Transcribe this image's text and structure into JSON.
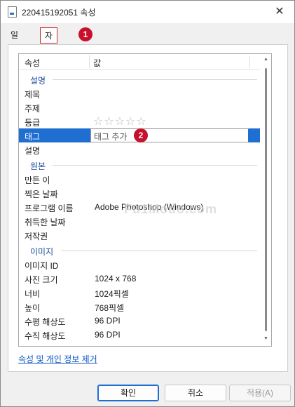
{
  "window": {
    "title": "220415192051 속성",
    "close_glyph": "✕"
  },
  "tabs": [
    {
      "label": "일반"
    },
    {
      "label": "자세히"
    }
  ],
  "markers": [
    "1",
    "2"
  ],
  "list": {
    "header": {
      "col1": "속성",
      "col2": "값"
    },
    "groups": {
      "description": "설명",
      "origin": "원본",
      "image": "이미지"
    },
    "rows": {
      "title": {
        "key": "제목",
        "value": ""
      },
      "subject": {
        "key": "주제",
        "value": ""
      },
      "rating": {
        "key": "등급",
        "value": "☆☆☆☆☆"
      },
      "tags": {
        "key": "태그",
        "value": "태그 추가"
      },
      "comments": {
        "key": "설명",
        "value": ""
      },
      "author": {
        "key": "만든 이",
        "value": ""
      },
      "date_taken": {
        "key": "찍은 날짜",
        "value": ""
      },
      "program": {
        "key": "프로그램 이름",
        "value": "Adobe Photoshop (Windows)"
      },
      "date_acquired": {
        "key": "취득한 날짜",
        "value": ""
      },
      "copyright": {
        "key": "저작권",
        "value": ""
      },
      "image_id": {
        "key": "이미지 ID",
        "value": ""
      },
      "dimensions": {
        "key": "사진 크기",
        "value": "1024 x 768"
      },
      "width": {
        "key": "너비",
        "value": "1024픽셀"
      },
      "height": {
        "key": "높이",
        "value": "768픽셀"
      },
      "hres": {
        "key": "수평 해상도",
        "value": "96 DPI"
      },
      "vres": {
        "key": "수직 해상도",
        "value": "96 DPI"
      }
    },
    "watermark": "Fu1Modo.com"
  },
  "remove_link": "속성 및 개인 정보 제거",
  "buttons": {
    "ok": "확인",
    "cancel": "취소",
    "apply": "적용(A)"
  },
  "colors": {
    "accent": "#1e6fd1",
    "marker": "#c8102e",
    "link": "#0b55c4"
  }
}
